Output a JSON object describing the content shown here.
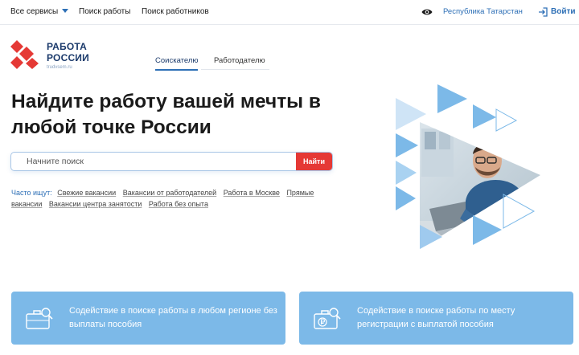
{
  "topbar": {
    "all_services": "Все сервисы",
    "job_search": "Поиск работы",
    "worker_search": "Поиск работников",
    "region": "Республика Татарстан",
    "login": "Войти"
  },
  "logo": {
    "line1": "РАБОТА",
    "line2": "РОССИИ",
    "domain": "trudvsem.ru"
  },
  "tabs": {
    "active": "Соискателю",
    "inactive": "Работодателю"
  },
  "hero": {
    "title": "Найдите работу вашей мечты в любой точке России"
  },
  "search": {
    "placeholder": "Начните поиск",
    "button": "Найти"
  },
  "frequent": {
    "label": "Часто ищут:",
    "links": [
      "Свежие вакансии",
      "Вакансии от работодателей",
      "Работа в Москве",
      "Прямые вакансии",
      "Вакансии центра занятости",
      "Работа без опыта"
    ]
  },
  "cards": [
    {
      "text": "Содействие в поиске работы в любом регионе без выплаты пособия",
      "icon": "briefcase-search-icon"
    },
    {
      "text": "Содействие в поиске работы по месту регистрации с выплатой пособия",
      "icon": "briefcase-ruble-icon"
    }
  ],
  "colors": {
    "brand_blue": "#2d6fb6",
    "brand_red": "#e53935",
    "card_blue": "#7cb9e8",
    "navy": "#1b3a6b"
  }
}
